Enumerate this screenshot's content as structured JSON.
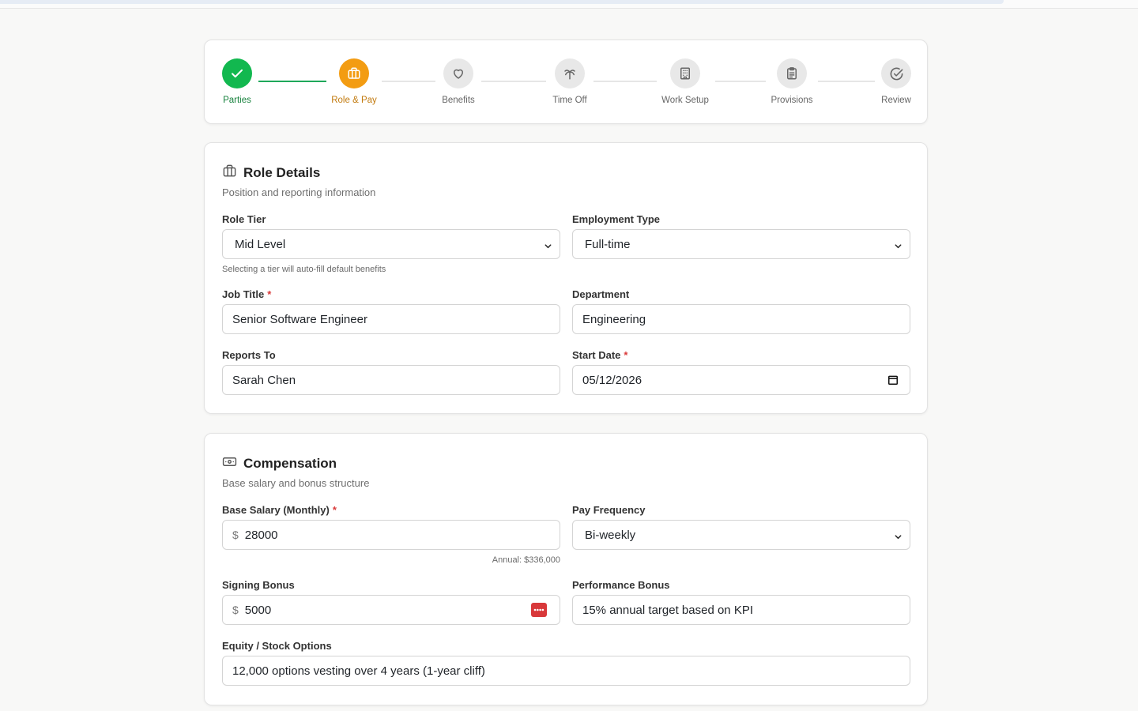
{
  "steps": [
    {
      "label": "Parties",
      "state": "done",
      "icon": "check-icon"
    },
    {
      "label": "Role & Pay",
      "state": "active",
      "icon": "briefcase-icon"
    },
    {
      "label": "Benefits",
      "state": "pending",
      "icon": "heart-icon"
    },
    {
      "label": "Time Off",
      "state": "pending",
      "icon": "palm-tree-icon"
    },
    {
      "label": "Work Setup",
      "state": "pending",
      "icon": "building-icon"
    },
    {
      "label": "Provisions",
      "state": "pending",
      "icon": "clipboard-icon"
    },
    {
      "label": "Review",
      "state": "pending",
      "icon": "check-circle-icon"
    }
  ],
  "role": {
    "title": "Role Details",
    "subtitle": "Position and reporting information",
    "role_tier_label": "Role Tier",
    "role_tier_value": "Mid Level",
    "role_tier_hint": "Selecting a tier will auto-fill default benefits",
    "employment_type_label": "Employment Type",
    "employment_type_value": "Full-time",
    "job_title_label": "Job Title",
    "job_title_value": "Senior Software Engineer",
    "department_label": "Department",
    "department_value": "Engineering",
    "reports_to_label": "Reports To",
    "reports_to_value": "Sarah Chen",
    "start_date_label": "Start Date",
    "start_date_value": "05/12/2026",
    "required_mark": "*"
  },
  "comp": {
    "title": "Compensation",
    "subtitle": "Base salary and bonus structure",
    "base_salary_label": "Base Salary (Monthly)",
    "base_salary_value": "28000",
    "annual_hint": "Annual: $336,000",
    "pay_frequency_label": "Pay Frequency",
    "pay_frequency_value": "Bi-weekly",
    "signing_bonus_label": "Signing Bonus",
    "signing_bonus_value": "5000",
    "performance_bonus_label": "Performance Bonus",
    "performance_bonus_value": "15% annual target based on KPI",
    "equity_label": "Equity / Stock Options",
    "equity_value": "12,000 options vesting over 4 years (1-year cliff)",
    "currency_symbol": "$",
    "required_mark": "*"
  },
  "colors": {
    "done": "#12b84f",
    "active": "#f39c12",
    "required": "#d93a3a"
  }
}
